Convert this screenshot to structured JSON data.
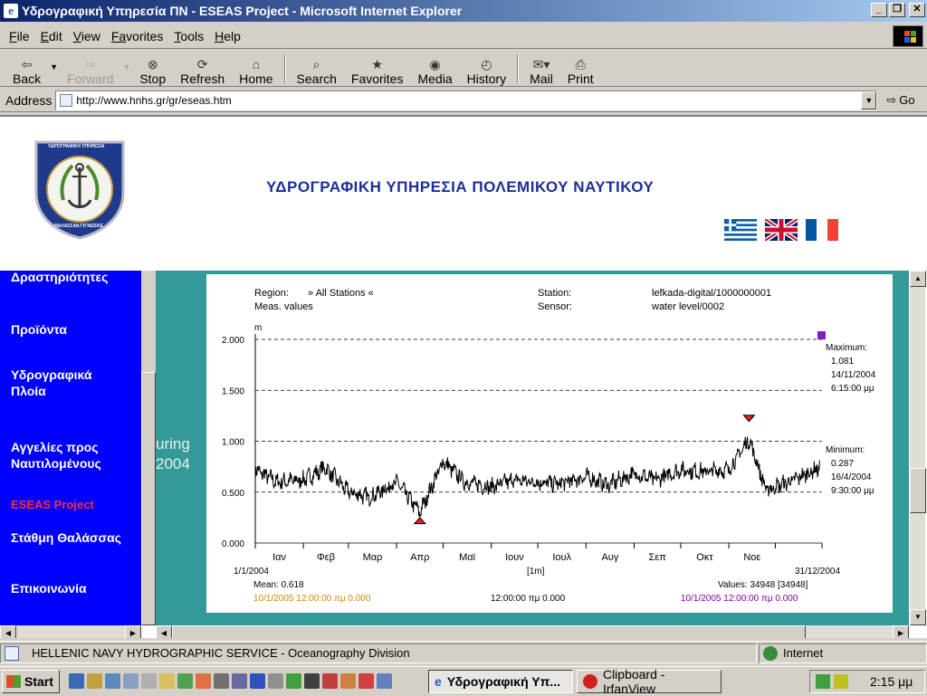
{
  "window": {
    "title": "Υδρογραφική Υπηρεσία ΠΝ - ESEAS Project - Microsoft Internet Explorer",
    "controls": [
      "_",
      "❐",
      "✕"
    ]
  },
  "menu": [
    {
      "underline": "F",
      "rest": "ile"
    },
    {
      "underline": "E",
      "rest": "dit"
    },
    {
      "underline": "V",
      "rest": "iew"
    },
    {
      "underline": "Fa",
      "rest": "vorites"
    },
    {
      "underline": "T",
      "rest": "ools"
    },
    {
      "underline": "H",
      "rest": "elp"
    }
  ],
  "toolbar": {
    "back": "Back",
    "forward": "Forward",
    "stop": "Stop",
    "refresh": "Refresh",
    "home": "Home",
    "search": "Search",
    "favorites": "Favorites",
    "media": "Media",
    "history": "History",
    "mail": "Mail",
    "print": "Print"
  },
  "address": {
    "label": "Address",
    "url": "http://www.hnhs.gr/gr/eseas.htm",
    "go": "Go"
  },
  "page": {
    "site_title": "ΥΔΡΟΓΡΑΦΙΚΗ ΥΠΗΡΕΣΙΑ ΠΟΛΕΜΙΚΟΥ ΝΑΥΤΙΚΟΥ",
    "emblem_top_text": "ΥΔΡΟΓΡΑΦΙΚΗ ΥΠΗΡΕΣΙΑ",
    "emblem_bottom_text": "ΘΑΛΑΣΣΑΝ ΓΙΓΝΩΣΚΕ",
    "nav": [
      {
        "label": "Δραστηριότητες"
      },
      {
        "label": "Προϊόντα"
      },
      {
        "label": "Υδρογραφικά",
        "label2": "Πλοία"
      },
      {
        "label": "Αγγελίες προς",
        "label2": "Ναυτιλομένους"
      },
      {
        "label": "ESEAS Project"
      },
      {
        "label": "Στάθμη Θαλάσσας"
      },
      {
        "label": "Επικοινωνία"
      }
    ],
    "bg_text_1": "uring",
    "bg_text_2": "2004"
  },
  "chart_data": {
    "type": "line",
    "region_label": "Region:",
    "region_value": "» All Stations «",
    "meas_label": "Meas. values",
    "station_label": "Station:",
    "station_value": "lefkada-digital/1000000001",
    "sensor_label": "Sensor:",
    "sensor_value": "water level/0002",
    "ylabel": "m",
    "ylim": [
      0,
      2
    ],
    "yticks": [
      "0.000",
      "0.500",
      "1.000",
      "1.500",
      "2.000"
    ],
    "months": [
      "Ιαν",
      "Φεβ",
      "Μαρ",
      "Απρ",
      "Μαϊ",
      "Ιουν",
      "Ιουλ",
      "Αυγ",
      "Σεπ",
      "Οκτ",
      "Νοε"
    ],
    "x_start": "1/1/2004",
    "x_end": "31/12/2004",
    "x_unit": "[1m]",
    "grid": "dashed horizontal",
    "max_label": "Maximum:",
    "max_value": "1.081",
    "max_date": "14/11/2004",
    "max_time": "6:15:00 μμ",
    "min_label": "Minimum:",
    "min_value": "0.287",
    "min_date": "16/4/2004",
    "min_time": "9:30:00 μμ",
    "mean_text": "Mean: 0.618",
    "values_text": "Values: 34948 [34948]",
    "footer_left": "10/1/2005 12:00:00 πμ   0.000",
    "footer_mid": "12:00:00 πμ   0.000",
    "footer_right": "10/1/2005 12:00:00 πμ   0.000",
    "footer_left_color": "#cc8800",
    "footer_right_color": "#8000a0",
    "series": [
      {
        "x": [
          "2004-01-01",
          "2004-01-15",
          "2004-02-01",
          "2004-02-15",
          "2004-03-01",
          "2004-03-15",
          "2004-04-01",
          "2004-04-16",
          "2004-05-01",
          "2004-05-15",
          "2004-06-01",
          "2004-06-15",
          "2004-07-01",
          "2004-07-15",
          "2004-08-01",
          "2004-08-15",
          "2004-09-01",
          "2004-09-15",
          "2004-10-01",
          "2004-10-15",
          "2004-11-01",
          "2004-11-14",
          "2004-11-25",
          "2004-12-10",
          "2004-12-31"
        ],
        "y": [
          0.72,
          0.6,
          0.62,
          0.74,
          0.5,
          0.45,
          0.6,
          0.3,
          0.8,
          0.6,
          0.55,
          0.62,
          0.6,
          0.58,
          0.65,
          0.57,
          0.68,
          0.62,
          0.72,
          0.7,
          0.72,
          1.02,
          0.52,
          0.6,
          0.75
        ]
      }
    ],
    "colors": {
      "line": "#000000",
      "max_marker": "#e02020",
      "min_marker": "#e02020",
      "corner_marker": "#8020c0"
    }
  },
  "status": {
    "text": "HELLENIC NAVY HYDROGRAPHIC SERVICE - Oceanography Division",
    "zone": "Internet"
  },
  "taskbar": {
    "start": "Start",
    "task1": "Υδρογραφική Υπ...",
    "task2": "Clipboard - IrfanView",
    "clock": "2:15 μμ"
  }
}
